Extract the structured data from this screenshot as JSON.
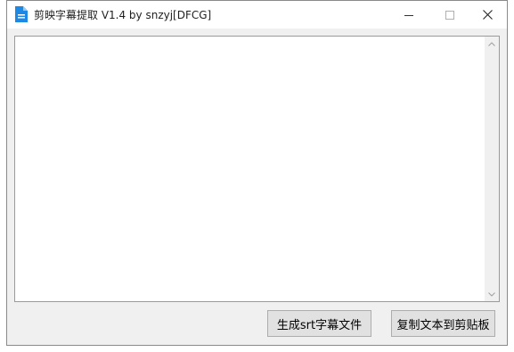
{
  "window": {
    "title": "剪映字幕提取 V1.4 by snzyj[DFCG]"
  },
  "icons": {
    "app": "document-icon",
    "minimize": "minimize-icon",
    "maximize": "maximize-icon",
    "close": "close-icon",
    "scroll_up": "chevron-up-icon",
    "scroll_down": "chevron-down-icon"
  },
  "text_area": {
    "value": ""
  },
  "buttons": {
    "generate_srt": "生成srt字幕文件",
    "copy_to_clipboard": "复制文本到剪贴板"
  },
  "colors": {
    "app_icon": "#1e88e5",
    "window_bg": "#f0f0f0",
    "button_bg": "#e1e1e1"
  }
}
